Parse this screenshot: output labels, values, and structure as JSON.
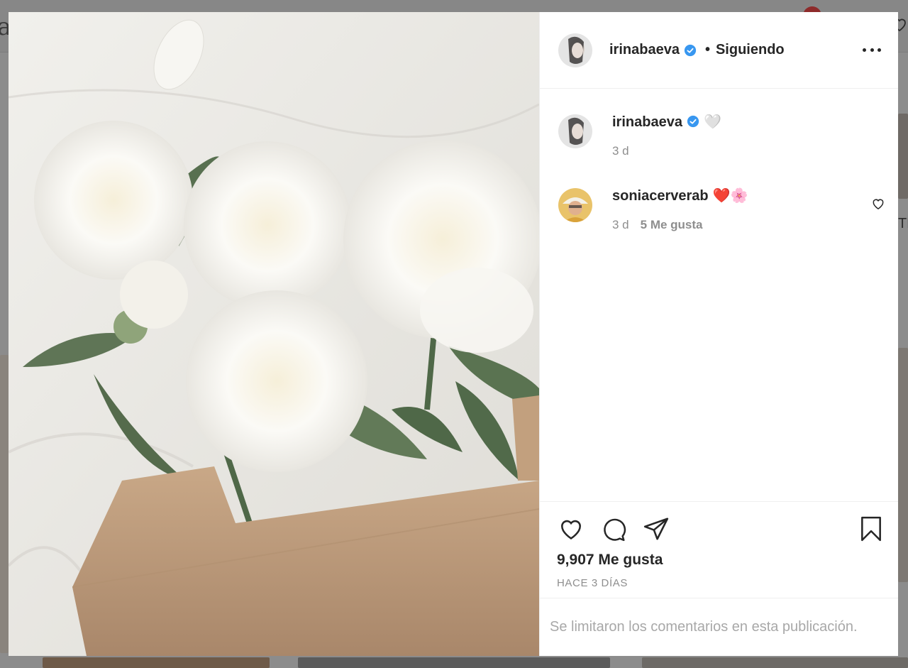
{
  "background": {
    "logo_text": "a",
    "side_text": "TL"
  },
  "post": {
    "author": {
      "username": "irinabaeva",
      "verified": true,
      "follow_status": "Siguiendo",
      "separator": "•"
    },
    "caption": {
      "username": "irinabaeva",
      "text": "🤍",
      "time": "3 d"
    },
    "comments": [
      {
        "username": "soniacerverab",
        "text": "❤️🌸",
        "time": "3 d",
        "likes": "5 Me gusta"
      }
    ],
    "likes": "9,907 Me gusta",
    "timestamp": "HACE 3 DÍAS",
    "comments_limited": "Se limitaron los comentarios en esta publicación.",
    "icons": {
      "more": "more-options-icon",
      "like": "heart-outline-icon",
      "comment": "comment-bubble-icon",
      "share": "paper-plane-icon",
      "save": "bookmark-icon",
      "verified": "verified-badge-icon"
    },
    "colors": {
      "verified": "#3897f0",
      "text": "#262626",
      "secondary": "#8e8e8e",
      "placeholder": "#a8a8a8"
    }
  }
}
